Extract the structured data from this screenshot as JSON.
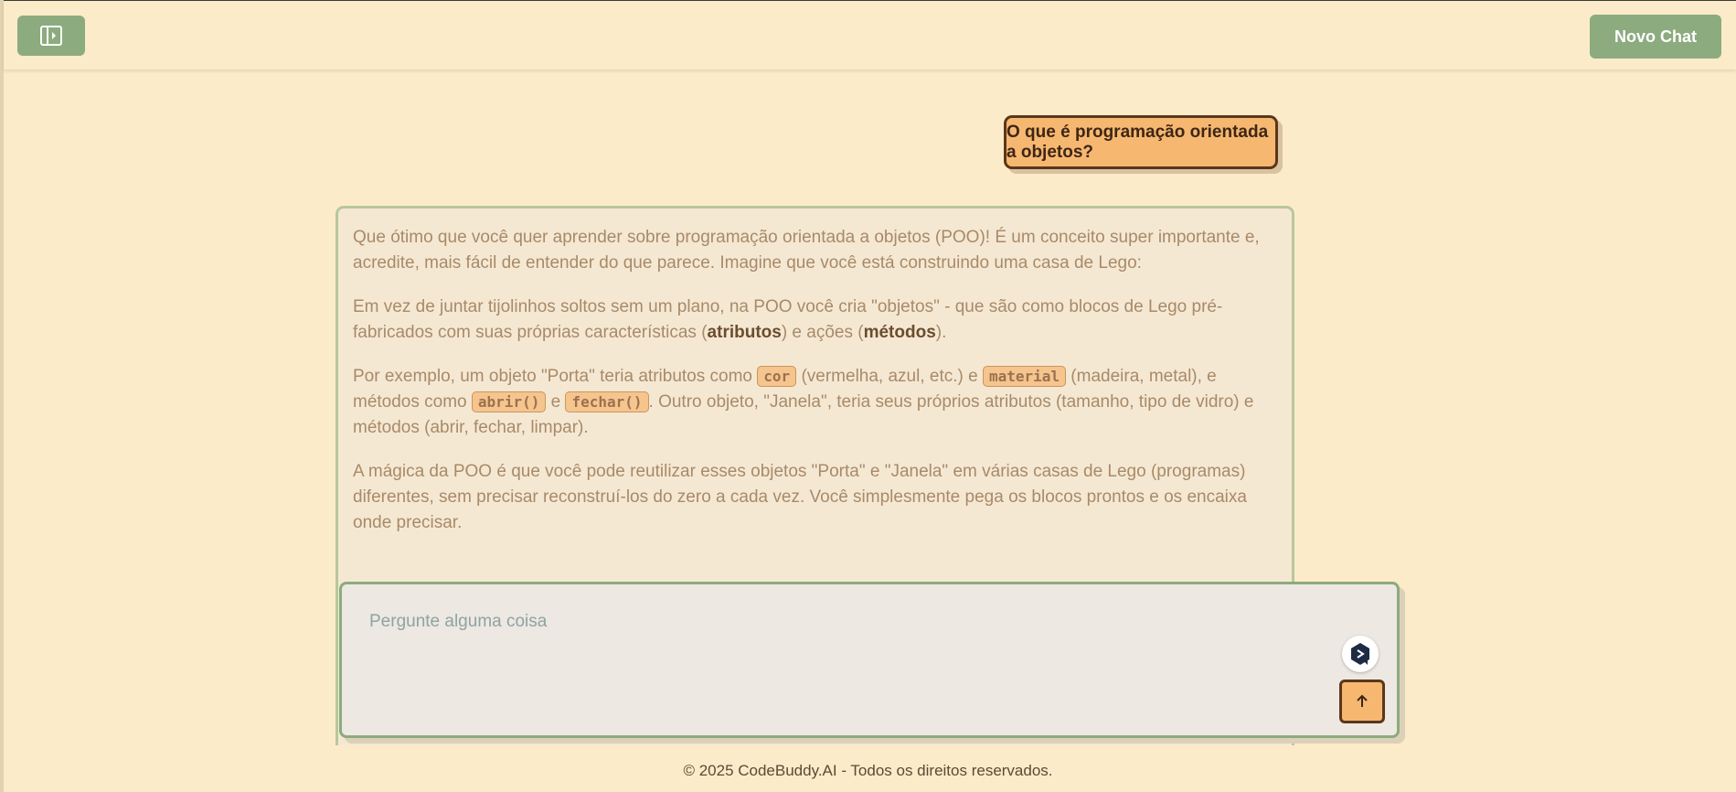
{
  "header": {
    "new_chat_label": "Novo Chat"
  },
  "conversation": {
    "user_message": "O que é programação orientada a objetos?",
    "ai_response": {
      "p1": "Que ótimo que você quer aprender sobre programação orientada a objetos (POO)! É um conceito super importante e, acredite, mais fácil de entender do que parece. Imagine que você está construindo uma casa de Lego:",
      "p2_a": "Em vez de juntar tijolinhos soltos sem um plano, na POO você cria \"objetos\" - que são como blocos de Lego pré-fabricados com suas próprias características (",
      "p2_bold1": "atributos",
      "p2_b": ") e ações (",
      "p2_bold2": "métodos",
      "p2_c": ").",
      "p3_a": "Por exemplo, um objeto \"Porta\" teria atributos como ",
      "p3_code1": "cor",
      "p3_b": " (vermelha, azul, etc.) e ",
      "p3_code2": "material",
      "p3_c": " (madeira, metal), e métodos como ",
      "p3_code3": "abrir()",
      "p3_d": " e ",
      "p3_code4": "fechar()",
      "p3_e": ". Outro objeto, \"Janela\", teria seus próprios atributos (tamanho, tipo de vidro) e métodos (abrir, fechar, limpar).",
      "p4": "A mágica da POO é que você pode reutilizar esses objetos \"Porta\" e \"Janela\" em várias casas de Lego (programas) diferentes, sem precisar reconstruí-los do zero a cada vez. Você simplesmente pega os blocos prontos e os encaixa onde precisar."
    }
  },
  "input": {
    "placeholder": "Pergunte alguma coisa",
    "value": ""
  },
  "icons": {
    "sidebar_toggle": "sidebar-toggle-icon",
    "assistant": "assistant-badge-icon",
    "send": "arrow-up-icon"
  },
  "colors": {
    "background": "#fcebc9",
    "accent_green": "#8cab7f",
    "accent_orange": "#f6b871",
    "dark_brown": "#5a371a"
  },
  "footer": {
    "text": "© 2025 CodeBuddy.AI - Todos os direitos reservados."
  }
}
